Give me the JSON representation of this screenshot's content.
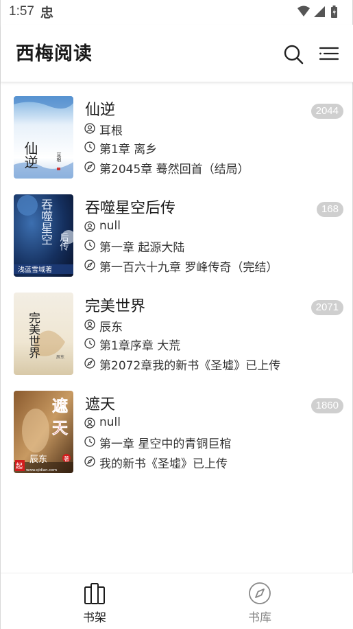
{
  "status_bar": {
    "time": "1:57",
    "carrier_glyph": "忠"
  },
  "app_bar": {
    "title": "西梅阅读"
  },
  "books": [
    {
      "title": "仙逆",
      "author": "耳根",
      "first_chapter": "第1章 离乡",
      "latest_chapter": "第2045章 蓦然回首（结局）",
      "badge": "2044"
    },
    {
      "title": "吞噬星空后传",
      "author": "null",
      "first_chapter": "第一章 起源大陆",
      "latest_chapter": "第一百六十九章 罗峰传奇（完结）",
      "badge": "168"
    },
    {
      "title": "完美世界",
      "author": "辰东",
      "first_chapter": "第1章序章 大荒",
      "latest_chapter": "第2072章我的新书《圣墟》已上传",
      "badge": "2071"
    },
    {
      "title": "遮天",
      "author": "null",
      "first_chapter": "第一章 星空中的青铜巨棺",
      "latest_chapter": "我的新书《圣墟》已上传",
      "badge": "1860"
    }
  ],
  "covers": {
    "book1": {
      "title_vertical": "仙逆",
      "author_small": "耳根"
    },
    "book2": {
      "title_vertical": "吞噬星空",
      "subtitle": "后传",
      "author_strip": "浅蓝雪域著"
    },
    "book3": {
      "title_vertical": "完美世界",
      "author_small": "辰东"
    },
    "book4": {
      "title_line1": "遮",
      "title_line2": "天",
      "author_strip": "辰东",
      "author_suffix": "著",
      "logo": "起",
      "url": "www.qidian.com"
    }
  },
  "bottom_nav": {
    "items": [
      {
        "label": "书架",
        "icon": "bookshelf-icon",
        "active": true
      },
      {
        "label": "书库",
        "icon": "compass-icon",
        "active": false
      }
    ]
  },
  "colors": {
    "badge": "#cfcfcf",
    "active_nav": "#1a1a1a",
    "inactive_nav": "#888888"
  }
}
